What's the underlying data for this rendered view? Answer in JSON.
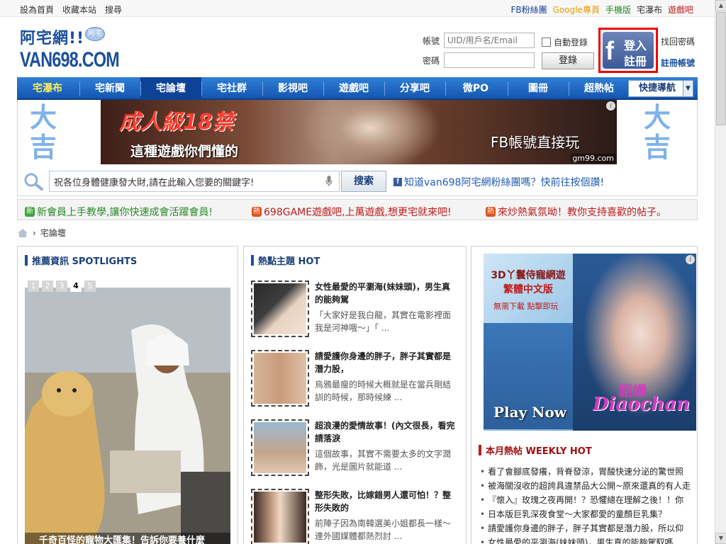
{
  "topbar": {
    "left": [
      "設為首頁",
      "收藏本站",
      "搜尋"
    ],
    "right": [
      {
        "label": "FB粉絲團",
        "color": "#1a3f9c"
      },
      {
        "label": "Google專頁",
        "color": "#e89b00"
      },
      {
        "label": "手機版",
        "color": "#2a8a2a"
      },
      {
        "label": "宅瀑布",
        "color": "#333333"
      },
      {
        "label": "遊戲吧",
        "color": "#c21a1a"
      }
    ]
  },
  "logo": {
    "line1": "阿宅網!!",
    "line2": "VAN698.COM",
    "bubble": "阿宅"
  },
  "login": {
    "account_label": "帳號",
    "account_placeholder": "UID/用戶名/Email",
    "password_label": "密碼",
    "auto_login": "自動登錄",
    "login_button": "登錄",
    "fb_line1": "登入",
    "fb_line2": "註冊",
    "fb_letter": "f",
    "recover": "找回密碼",
    "register": "註冊帳號"
  },
  "nav": {
    "items": [
      "宅瀑布",
      "宅新聞",
      "宅論壇",
      "宅社群",
      "影視吧",
      "遊戲吧",
      "分享吧",
      "微PO",
      "圖冊",
      "超熱帖"
    ],
    "active_index": 2,
    "quick_nav": "快捷導航"
  },
  "banner": {
    "side_text": "大吉",
    "ad_line1": "成人級18禁",
    "ad_line2": "這種遊戲你們懂的",
    "ad_line3": "FB帳號直接玩",
    "ad_domain": "gm99.com",
    "ad_info": "i"
  },
  "search": {
    "value": "祝各位身體健康發大財,請在此輸入您要的關鍵字!",
    "button": "搜索",
    "fb_letter": "f",
    "fan_link": "知道van698阿宅網粉絲團嗎？快前往按個讚!"
  },
  "notices": [
    {
      "tag": "新",
      "tag_color": "#3aa53a",
      "text": "新會員上手教學,讓你快速成會活躍會員!",
      "color": "#2a8a2a"
    },
    {
      "tag": "熱",
      "tag_color": "#e0531a",
      "text": "698GAME遊戲吧,上萬遊戲,想更宅就來吧!",
      "color": "#c21a1a"
    },
    {
      "tag": "熱",
      "tag_color": "#e0531a",
      "text": "來炒熱氣氛呦！教你支持喜歡的帖子。",
      "color": "#c21a1a"
    }
  ],
  "breadcrumb": {
    "current": "宅論壇"
  },
  "spotlights": {
    "title": "推薦資訊 SPOTLIGHTS",
    "nums": [
      "1",
      "2",
      "3",
      "4",
      "5"
    ],
    "active_num": 3,
    "caption": "千奇百怪的寵物大匯集！告訴你要養什麼"
  },
  "hot": {
    "title": "熱點主題 HOT",
    "items": [
      {
        "title": "女性最愛的平瀏海(妹妹頭)，男生真的能夠駕",
        "desc": "「大家好是我白龍，其實在電影裡面我是河神哦～」「 ..."
      },
      {
        "title": "請愛護你身邊的胖子，胖子其實都是潛力股，",
        "desc": "烏鴉最瘦的時候大概就是在當兵剛結訓的時候，那時候練 ..."
      },
      {
        "title": "超浪漫的愛情故事！(內文很長，看完請落淚",
        "desc": "這個故事，其實不需要太多的文字潤飾，光是圖片就能道 ..."
      },
      {
        "title": "整形失敗，比嫁錯男人還可怕！？整形失敗的",
        "desc": "前陣子因為南韓選美小姐都長一樣～連外國媒體都熱烈討 ..."
      }
    ]
  },
  "right_ad": {
    "line1": "3D丫鬟侍寵網遊",
    "line2": "繁體中文版",
    "line3": "無需下載 點擊即玩",
    "play": "Play Now",
    "name_cn": "貂蟬",
    "name_en": "Diaochan",
    "info": "i"
  },
  "weekly": {
    "title": "本月熱帖 WEEKLY HOT",
    "items": [
      "看了會腳底發癢，背脊發涼，胃酸快速分泌的驚世照",
      "被海關沒收的超誇具違禁品大公開~原來還真的有人走",
      "『懷入』玫瑰之夜再開！？恐懼總在理解之後！！你",
      "日本版巨乳深夜食堂～大家都愛的童顏巨乳集？",
      "請愛護你身邊的胖子，胖子其實都是潛力股，所以仰",
      "女性最愛的平瀏海(妹妹頭)，男生真的能夠駕馭嗎"
    ]
  }
}
